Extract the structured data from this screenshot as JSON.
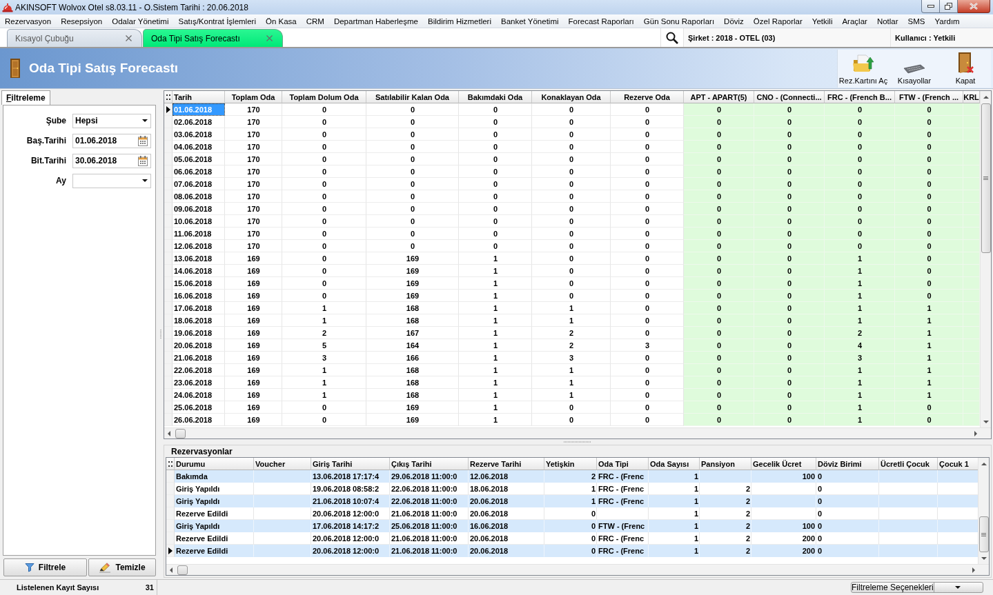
{
  "window": {
    "title": "AKINSOFT Wolvox Otel s8.03.11 - O.Sistem Tarihi : 20.06.2018"
  },
  "menu": [
    "Rezervasyon",
    "Resepsiyon",
    "Odalar Yönetimi",
    "Satış/Kontrat İşlemleri",
    "Ön Kasa",
    "CRM",
    "Departman Haberleşme",
    "Bildirim Hizmetleri",
    "Banket Yönetimi",
    "Forecast Raporları",
    "Gün Sonu Raporları",
    "Döviz",
    "Özel Raporlar",
    "Yetkili",
    "Araçlar",
    "Notlar",
    "SMS",
    "Yardım"
  ],
  "tabs": [
    {
      "label": "Kısayol Çubuğu",
      "selected": false
    },
    {
      "label": "Oda Tipi Satış Forecastı",
      "selected": true
    }
  ],
  "session": {
    "company": "Şirket : 2018 - OTEL (03)",
    "user": "Kullanıcı : Yetkili"
  },
  "page": {
    "title": "Oda Tipi Satış Forecastı"
  },
  "toolbar": [
    {
      "kind": "open_card",
      "label": "Rez.Kartını Aç"
    },
    {
      "kind": "shortcuts",
      "label": "Kısayollar"
    },
    {
      "kind": "close",
      "label": "Kapat"
    }
  ],
  "filter_panel": {
    "tab": "Filtreleme",
    "fields": [
      {
        "kind": "select",
        "label": "Şube",
        "value": "Hepsi"
      },
      {
        "kind": "date",
        "label": "Baş.Tarihi",
        "value": "01.06.2018"
      },
      {
        "kind": "date",
        "label": "Bit.Tarihi",
        "value": "30.06.2018"
      },
      {
        "kind": "select",
        "label": "Ay"
      }
    ],
    "buttons": [
      {
        "kind": "filter",
        "label": "Filtrele"
      },
      {
        "kind": "clear",
        "label": "Temizle"
      }
    ]
  },
  "forecast_table": {
    "columns": [
      {
        "label": "Tarih",
        "kind": "date"
      },
      {
        "label": "Toplam Oda",
        "kind": "count"
      },
      {
        "label": "Toplam Dolum Oda",
        "kind": "count"
      },
      {
        "label": "Satılabilir Kalan Oda",
        "kind": "count"
      },
      {
        "label": "Bakımdaki Oda",
        "kind": "count"
      },
      {
        "label": "Konaklayan Oda",
        "kind": "count"
      },
      {
        "label": "Rezerve Oda",
        "kind": "count"
      },
      {
        "label": "APT - APART(5)",
        "kind": "room_type"
      },
      {
        "label": "CNO - (Connecti...",
        "kind": "room_type"
      },
      {
        "label": "FRC - (French B...",
        "kind": "room_type"
      },
      {
        "label": "FTW - (French ...",
        "kind": "room_type"
      },
      {
        "label": "KRL",
        "kind": "room_type"
      }
    ],
    "rows": [
      {
        "selected": true,
        "cells": [
          "01.06.2018",
          "170",
          "0",
          "0",
          "0",
          "0",
          "0",
          "0",
          "0",
          "0",
          "0"
        ]
      },
      {
        "selected": false,
        "cells": [
          "02.06.2018",
          "170",
          "0",
          "0",
          "0",
          "0",
          "0",
          "0",
          "0",
          "0",
          "0"
        ]
      },
      {
        "selected": false,
        "cells": [
          "03.06.2018",
          "170",
          "0",
          "0",
          "0",
          "0",
          "0",
          "0",
          "0",
          "0",
          "0"
        ]
      },
      {
        "selected": false,
        "cells": [
          "04.06.2018",
          "170",
          "0",
          "0",
          "0",
          "0",
          "0",
          "0",
          "0",
          "0",
          "0"
        ]
      },
      {
        "selected": false,
        "cells": [
          "05.06.2018",
          "170",
          "0",
          "0",
          "0",
          "0",
          "0",
          "0",
          "0",
          "0",
          "0"
        ]
      },
      {
        "selected": false,
        "cells": [
          "06.06.2018",
          "170",
          "0",
          "0",
          "0",
          "0",
          "0",
          "0",
          "0",
          "0",
          "0"
        ]
      },
      {
        "selected": false,
        "cells": [
          "07.06.2018",
          "170",
          "0",
          "0",
          "0",
          "0",
          "0",
          "0",
          "0",
          "0",
          "0"
        ]
      },
      {
        "selected": false,
        "cells": [
          "08.06.2018",
          "170",
          "0",
          "0",
          "0",
          "0",
          "0",
          "0",
          "0",
          "0",
          "0"
        ]
      },
      {
        "selected": false,
        "cells": [
          "09.06.2018",
          "170",
          "0",
          "0",
          "0",
          "0",
          "0",
          "0",
          "0",
          "0",
          "0"
        ]
      },
      {
        "selected": false,
        "cells": [
          "10.06.2018",
          "170",
          "0",
          "0",
          "0",
          "0",
          "0",
          "0",
          "0",
          "0",
          "0"
        ]
      },
      {
        "selected": false,
        "cells": [
          "11.06.2018",
          "170",
          "0",
          "0",
          "0",
          "0",
          "0",
          "0",
          "0",
          "0",
          "0"
        ]
      },
      {
        "selected": false,
        "cells": [
          "12.06.2018",
          "170",
          "0",
          "0",
          "0",
          "0",
          "0",
          "0",
          "0",
          "0",
          "0"
        ]
      },
      {
        "selected": false,
        "cells": [
          "13.06.2018",
          "169",
          "0",
          "169",
          "1",
          "0",
          "0",
          "0",
          "0",
          "1",
          "0"
        ]
      },
      {
        "selected": false,
        "cells": [
          "14.06.2018",
          "169",
          "0",
          "169",
          "1",
          "0",
          "0",
          "0",
          "0",
          "1",
          "0"
        ]
      },
      {
        "selected": false,
        "cells": [
          "15.06.2018",
          "169",
          "0",
          "169",
          "1",
          "0",
          "0",
          "0",
          "0",
          "1",
          "0"
        ]
      },
      {
        "selected": false,
        "cells": [
          "16.06.2018",
          "169",
          "0",
          "169",
          "1",
          "0",
          "0",
          "0",
          "0",
          "1",
          "0"
        ]
      },
      {
        "selected": false,
        "cells": [
          "17.06.2018",
          "169",
          "1",
          "168",
          "1",
          "1",
          "0",
          "0",
          "0",
          "1",
          "1"
        ]
      },
      {
        "selected": false,
        "cells": [
          "18.06.2018",
          "169",
          "1",
          "168",
          "1",
          "1",
          "0",
          "0",
          "0",
          "1",
          "1"
        ]
      },
      {
        "selected": false,
        "cells": [
          "19.06.2018",
          "169",
          "2",
          "167",
          "1",
          "2",
          "0",
          "0",
          "0",
          "2",
          "1"
        ]
      },
      {
        "selected": false,
        "cells": [
          "20.06.2018",
          "169",
          "5",
          "164",
          "1",
          "2",
          "3",
          "0",
          "0",
          "4",
          "1"
        ]
      },
      {
        "selected": false,
        "cells": [
          "21.06.2018",
          "169",
          "3",
          "166",
          "1",
          "3",
          "0",
          "0",
          "0",
          "3",
          "1"
        ]
      },
      {
        "selected": false,
        "cells": [
          "22.06.2018",
          "169",
          "1",
          "168",
          "1",
          "1",
          "0",
          "0",
          "0",
          "1",
          "1"
        ]
      },
      {
        "selected": false,
        "cells": [
          "23.06.2018",
          "169",
          "1",
          "168",
          "1",
          "1",
          "0",
          "0",
          "0",
          "1",
          "1"
        ]
      },
      {
        "selected": false,
        "cells": [
          "24.06.2018",
          "169",
          "1",
          "168",
          "1",
          "1",
          "0",
          "0",
          "0",
          "1",
          "1"
        ]
      },
      {
        "selected": false,
        "cells": [
          "25.06.2018",
          "169",
          "0",
          "169",
          "1",
          "0",
          "0",
          "0",
          "0",
          "1",
          "0"
        ]
      },
      {
        "selected": false,
        "cells": [
          "26.06.2018",
          "169",
          "0",
          "169",
          "1",
          "0",
          "0",
          "0",
          "0",
          "1",
          "0"
        ]
      }
    ]
  },
  "reservations": {
    "title": "Rezervasyonlar",
    "columns": [
      {
        "label": "Durumu",
        "kind": "text"
      },
      {
        "label": "Voucher",
        "kind": "text"
      },
      {
        "label": "Giriş Tarihi",
        "kind": "text"
      },
      {
        "label": "Çıkış Tarihi",
        "kind": "text"
      },
      {
        "label": "Rezerve Tarihi",
        "kind": "text"
      },
      {
        "label": "Yetişkin",
        "kind": "number"
      },
      {
        "label": "Oda Tipi",
        "kind": "text"
      },
      {
        "label": "Oda Sayısı",
        "kind": "number"
      },
      {
        "label": "Pansiyon",
        "kind": "number"
      },
      {
        "label": "Gecelik Ücret",
        "kind": "number"
      },
      {
        "label": "Döviz Birimi",
        "kind": "text"
      },
      {
        "label": "Ücretli Çocuk",
        "kind": "number"
      },
      {
        "label": "Çocuk 1",
        "kind": "number"
      }
    ],
    "rows": [
      {
        "selected": false,
        "cells": [
          "Bakımda",
          null,
          "13.06.2018 17:17:4",
          "29.06.2018 11:00:0",
          "12.06.2018",
          "2",
          "FRC - (Frenc",
          "1",
          null,
          "100",
          "0"
        ]
      },
      {
        "selected": false,
        "cells": [
          "Giriş Yapıldı",
          null,
          "19.06.2018 08:58:2",
          "22.06.2018 11:00:0",
          "18.06.2018",
          "1",
          "FRC - (Frenc",
          "1",
          "2",
          null,
          "0"
        ]
      },
      {
        "selected": false,
        "cells": [
          "Giriş Yapıldı",
          null,
          "21.06.2018 10:07:4",
          "22.06.2018 11:00:0",
          "20.06.2018",
          "1",
          "FRC - (Frenc",
          "1",
          "2",
          null,
          "0"
        ]
      },
      {
        "selected": false,
        "cells": [
          "Rezerve Edildi",
          null,
          "20.06.2018 12:00:0",
          "21.06.2018 11:00:0",
          "20.06.2018",
          "0",
          null,
          "1",
          "2",
          null,
          "0"
        ]
      },
      {
        "selected": false,
        "cells": [
          "Giriş Yapıldı",
          null,
          "17.06.2018 14:17:2",
          "25.06.2018 11:00:0",
          "16.06.2018",
          "0",
          "FTW - (Frenc",
          "1",
          "2",
          "100",
          "0"
        ]
      },
      {
        "selected": false,
        "cells": [
          "Rezerve Edildi",
          null,
          "20.06.2018 12:00:0",
          "21.06.2018 11:00:0",
          "20.06.2018",
          "0",
          "FRC - (Frenc",
          "1",
          "2",
          "200",
          "0"
        ]
      },
      {
        "selected": true,
        "cells": [
          "Rezerve Edildi",
          null,
          "20.06.2018 12:00:0",
          "21.06.2018 11:00:0",
          "20.06.2018",
          "0",
          "FRC - (Frenc",
          "1",
          "2",
          "200",
          "0"
        ]
      }
    ]
  },
  "status_bar": {
    "count_label": "Listelenen Kayıt Sayısı",
    "count": "31",
    "filter_options": "Filtreleme Seçenekleri"
  }
}
